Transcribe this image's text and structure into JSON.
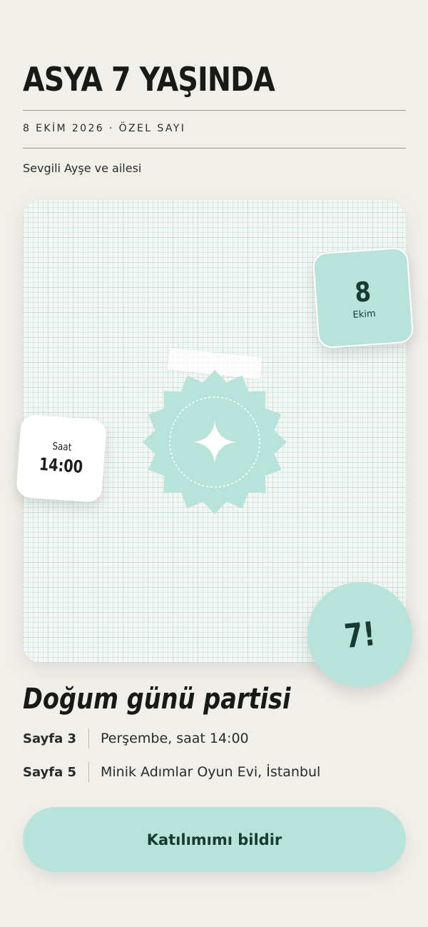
{
  "header": {
    "title": "ASYA 7 YAŞINDA",
    "issue_line": "8 EKİM 2026 · ÖZEL SAYI",
    "greeting": "Sevgili Ayşe ve ailesi"
  },
  "card": {
    "date_note": {
      "day": "8",
      "month": "Ekim"
    },
    "time_note": {
      "label": "Saat",
      "time": "14:00"
    },
    "badge_icon": "sparkle-icon",
    "age_circle": "7!"
  },
  "details": {
    "title": "Doğum günü partisi",
    "rows": [
      {
        "label": "Sayfa 3",
        "value": "Perşembe, saat 14:00"
      },
      {
        "label": "Sayfa 5",
        "value": "Minik Adımlar Oyun Evi, İstanbul"
      }
    ]
  },
  "cta": {
    "label": "Katılımımı bildir"
  },
  "colors": {
    "background": "#f1efea",
    "accent_mint": "#b8e3da",
    "accent_dark": "#173a33",
    "text": "#1d1d1b"
  }
}
